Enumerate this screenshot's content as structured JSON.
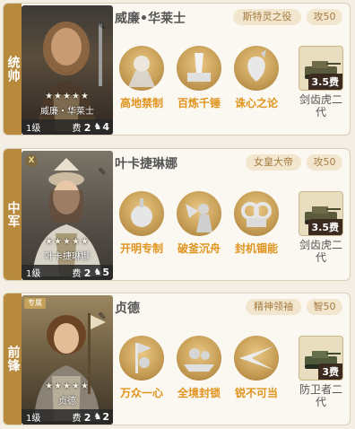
{
  "cards": [
    {
      "position": "统帅",
      "name": "威廉•华莱士",
      "portrait_name": "威廉・华莱士",
      "tags": [
        "斯特灵之役",
        "攻50"
      ],
      "level": "1级",
      "cost_label": "费",
      "cost": "2",
      "troop_count": "4",
      "stars": "★★★★★",
      "skills": [
        "高地禁制",
        "百炼千锤",
        "诛心之论"
      ],
      "unit": {
        "cost": "3.5费",
        "name": "剑齿虎二代"
      }
    },
    {
      "position": "中军",
      "name": "叶卡捷琳娜",
      "portrait_name": "叶卡捷琳娜",
      "tags": [
        "女皇大帝",
        "攻50"
      ],
      "level": "1级",
      "cost_label": "费",
      "cost": "2",
      "troop_count": "5",
      "stars": "★★★★★",
      "badge": "X",
      "skills": [
        "开明专制",
        "破釜沉舟",
        "封机锢能"
      ],
      "unit": {
        "cost": "3.5费",
        "name": "剑齿虎二代"
      }
    },
    {
      "position": "前锋",
      "name": "贞德",
      "portrait_name": "贞德",
      "tags": [
        "精神领袖",
        "智50"
      ],
      "level": "1级",
      "cost_label": "费",
      "cost": "2",
      "troop_count": "2",
      "stars": "★★★★★",
      "badge": "专属",
      "skills": [
        "万众一心",
        "全境封锁",
        "锐不可当"
      ],
      "unit": {
        "cost": "3费",
        "name": "防卫者二代"
      }
    }
  ],
  "colors": {
    "accent": "#e0941e",
    "strip": "#b88a3e",
    "tag_bg": "#f2e6cf",
    "tag_text": "#a67c40"
  }
}
